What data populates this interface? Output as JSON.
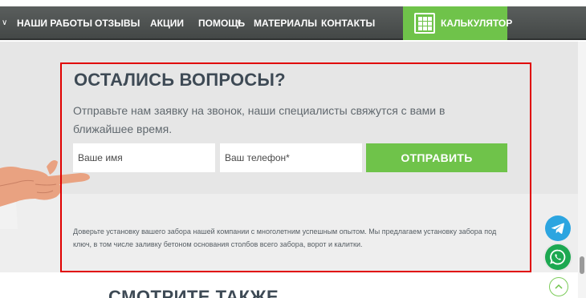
{
  "nav": {
    "items": [
      {
        "label": "НАШИ РАБОТЫ",
        "dropdown": false
      },
      {
        "label": "ОТЗЫВЫ",
        "dropdown": false
      },
      {
        "label": "АКЦИИ",
        "dropdown": false
      },
      {
        "label": "ПОМОЩЬ",
        "dropdown": true
      },
      {
        "label": "МАТЕРИАЛЫ",
        "dropdown": false
      },
      {
        "label": "КОНТАКТЫ",
        "dropdown": false
      }
    ],
    "calculator_label": "КАЛЬКУЛЯТОР",
    "chevron_glyph": "∨"
  },
  "form": {
    "title": "ОСТАЛИСЬ ВОПРОСЫ?",
    "subtitle": "Отправьте нам заявку на звонок, наши специалисты свяжутся с вами в ближайшее время.",
    "name_placeholder": "Ваше имя",
    "phone_placeholder": "Ваш телефон*",
    "submit_label": "ОТПРАВИТЬ",
    "disclaimer": "Доверьте установку вашего забора нашей компании с многолетним успешным опытом. Мы предлагаем установку забора под ключ, в том числе заливку бетоном основания столбов всего забора, ворот и калитки."
  },
  "section": {
    "see_also_title": "СМОТРИТЕ ТАКЖЕ"
  },
  "icons": {
    "calculator": "calculator-icon",
    "telegram": "telegram-icon",
    "whatsapp": "whatsapp-icon",
    "scroll_up": "chevron-up-icon"
  },
  "colors": {
    "accent_green": "#6fc34a",
    "nav_bg": "#4e5251",
    "highlight_red": "#e00000",
    "telegram_blue": "#2ca5e0",
    "whatsapp_green": "#1da851"
  }
}
